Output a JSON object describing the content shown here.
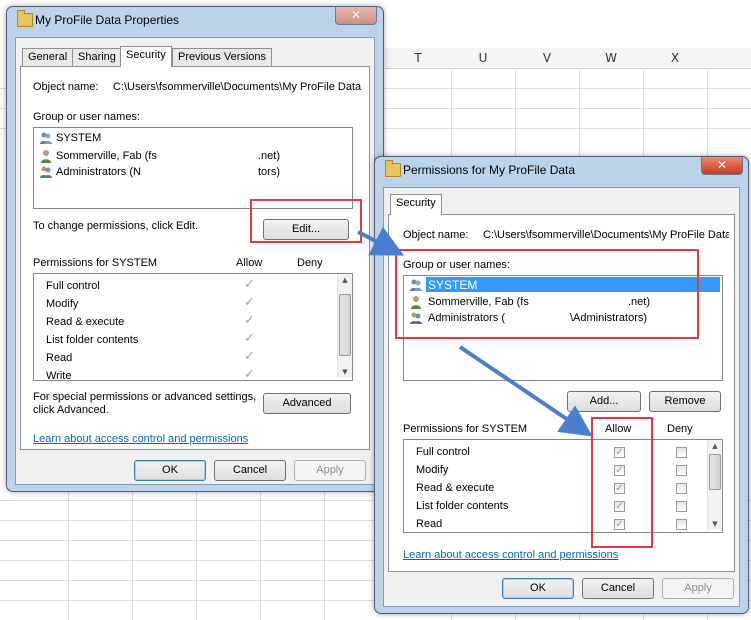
{
  "spreadsheet": {
    "columns": [
      "T",
      "U",
      "V",
      "W",
      "X"
    ]
  },
  "properties_dialog": {
    "title": "My ProFile Data Properties",
    "close": "✕",
    "tabs": [
      "General",
      "Sharing",
      "Security",
      "Previous Versions"
    ],
    "object_name_label": "Object name:",
    "object_name_value": "C:\\Users\\fsommerville\\Documents\\My ProFile Data",
    "group_label": "Group or user names:",
    "users": [
      "SYSTEM",
      "Sommerville, Fab (fs",
      ".net)",
      "Administrators (N",
      "tors)"
    ],
    "change_text": "To change permissions, click Edit.",
    "edit_button": "Edit...",
    "permissions_label": "Permissions for SYSTEM",
    "allow_header": "Allow",
    "deny_header": "Deny",
    "permissions": [
      "Full control",
      "Modify",
      "Read & execute",
      "List folder contents",
      "Read",
      "Write"
    ],
    "special_text_1": "For special permissions or advanced settings,",
    "special_text_2": "click Advanced.",
    "advanced_button": "Advanced",
    "learn_link": "Learn about access control and permissions",
    "ok": "OK",
    "cancel": "Cancel",
    "apply": "Apply"
  },
  "permissions_dialog": {
    "title": "Permissions for My ProFile Data",
    "close": "✕",
    "tab": "Security",
    "object_name_label": "Object name:",
    "object_name_value": "C:\\Users\\fsommerville\\Documents\\My ProFile Data",
    "group_label": "Group or user names:",
    "users": [
      "SYSTEM",
      "Sommerville, Fab (fs",
      ".net)",
      "Administrators (",
      "\\Administrators)"
    ],
    "add_button": "Add...",
    "remove_button": "Remove",
    "permissions_label": "Permissions for SYSTEM",
    "allow_header": "Allow",
    "deny_header": "Deny",
    "permissions": [
      "Full control",
      "Modify",
      "Read & execute",
      "List folder contents",
      "Read"
    ],
    "learn_link": "Learn about access control and permissions",
    "ok": "OK",
    "cancel": "Cancel",
    "apply": "Apply"
  },
  "colors": {
    "annotation_red": "#e03c3c",
    "arrow_blue": "#4a7fd0",
    "selection": "#3399ff",
    "link": "#0066cc"
  }
}
